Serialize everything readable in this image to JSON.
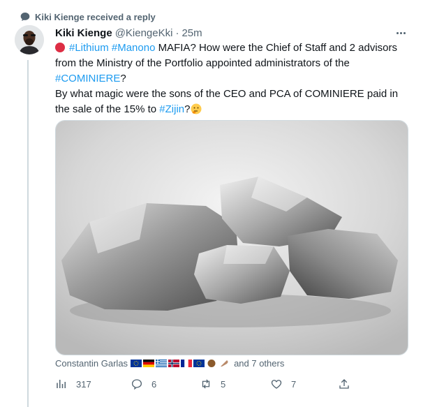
{
  "notification": {
    "text": "Kiki Kienge received a reply"
  },
  "tweet": {
    "author_name": "Kiki Kienge",
    "handle": "@KiengeKki",
    "separator": "·",
    "time": "25m",
    "line1_tags": [
      "#Lithium",
      "#Manono"
    ],
    "line1_rest": " MAFIA?   How were the Chief of Staff and 2 advisors from the Ministry of the Portfolio appointed administrators of the ",
    "line1_end_tag": "#COMINIERE",
    "line1_end": "?",
    "line2_text": "By what magic were the sons of the CEO and PCA of COMINIERE paid in the sale of the 15% to ",
    "line2_tag": "#Zijin",
    "line2_end": "?"
  },
  "likes": {
    "first_liker": "Constantin Garlas",
    "others": "and 7 others",
    "flags": [
      "eu-flag",
      "germany-flag",
      "greece-flag",
      "norway-flag",
      "france-flag",
      "eu-flag",
      "brown-circle-emoji",
      "feather-emoji"
    ]
  },
  "actions": {
    "views": "317",
    "replies": "6",
    "retweets": "5",
    "likes": "7"
  },
  "colors": {
    "link": "#1d9bf0",
    "muted": "#536471",
    "text": "#0f1419"
  }
}
